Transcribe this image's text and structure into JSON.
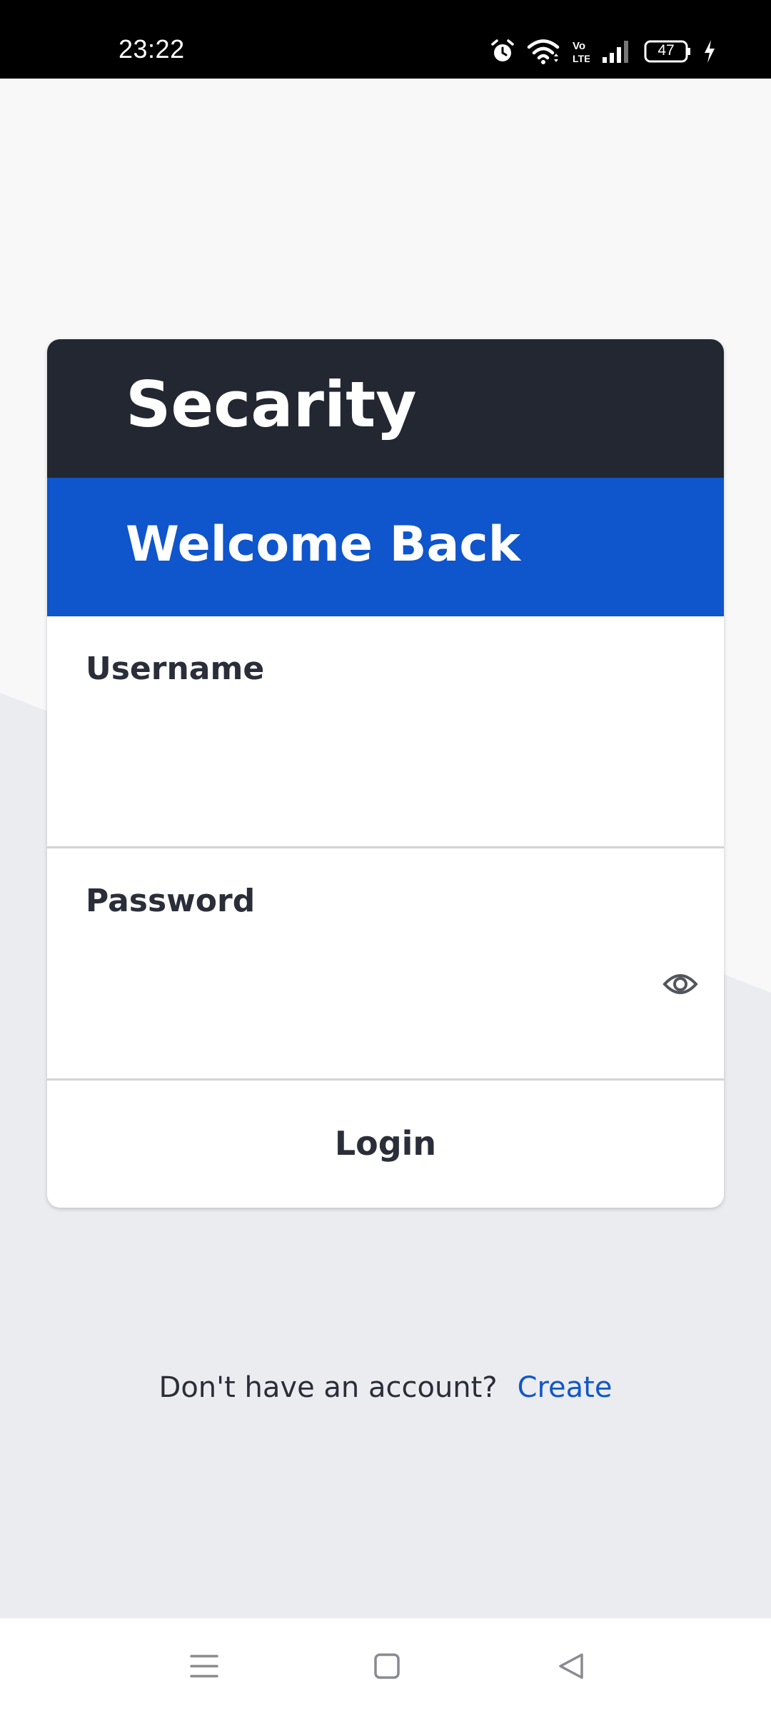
{
  "status_bar": {
    "time": "23:22",
    "battery": "47",
    "icons": [
      "alarm-icon",
      "wifi-icon",
      "volte-icon",
      "signal-icon",
      "battery-icon",
      "charging-icon"
    ]
  },
  "card": {
    "brand": "Secarity",
    "welcome": "Welcome Back",
    "username_label": "Username",
    "username_value": "",
    "password_label": "Password",
    "password_value": "",
    "login_label": "Login"
  },
  "signup": {
    "prompt": "Don't have an account?",
    "link": "Create"
  },
  "nav": {
    "icons": [
      "menu-icon",
      "home-square-icon",
      "back-triangle-icon"
    ]
  },
  "colors": {
    "header_dark": "#222731",
    "header_blue": "#0f55cc",
    "link_blue": "#1158c7",
    "text_dark": "#2a2e39",
    "bg_light": "#f8f8f9",
    "bg_gray": "#ebecf0"
  }
}
